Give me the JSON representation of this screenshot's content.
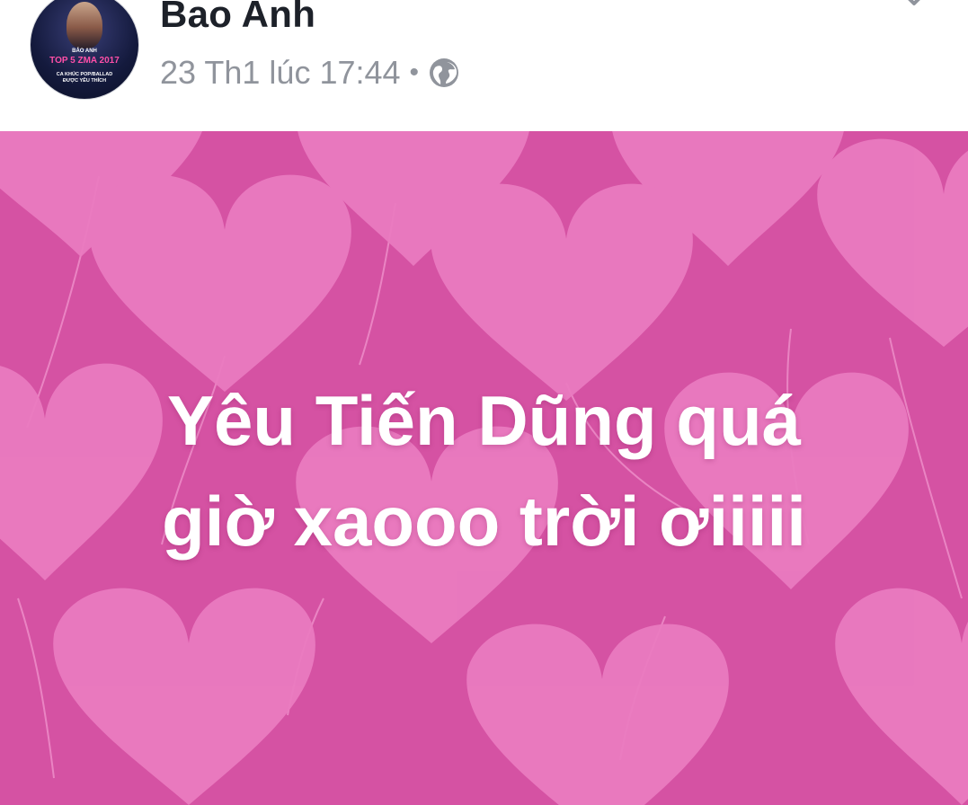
{
  "post": {
    "author": "Bao Anh",
    "date": "23 Th1 lúc 17:44",
    "separator": "•",
    "privacy_icon": "globe-icon",
    "menu_icon": "chevron-down-icon",
    "avatar": {
      "line1": "BẢO ANH",
      "line2": "TOP 5 ZMA 2017",
      "line3a": "CA KHÚC POP/BALLAD",
      "line3b": "ĐƯỢC YÊU THÍCH"
    },
    "status_lines": [
      "Yêu Tiến Dũng quá",
      "giờ xaooo trời ơiiiii"
    ],
    "background": {
      "base_color": "#d552a3",
      "heart_color": "#ea7bc0",
      "string_color": "#f29ad0"
    }
  }
}
